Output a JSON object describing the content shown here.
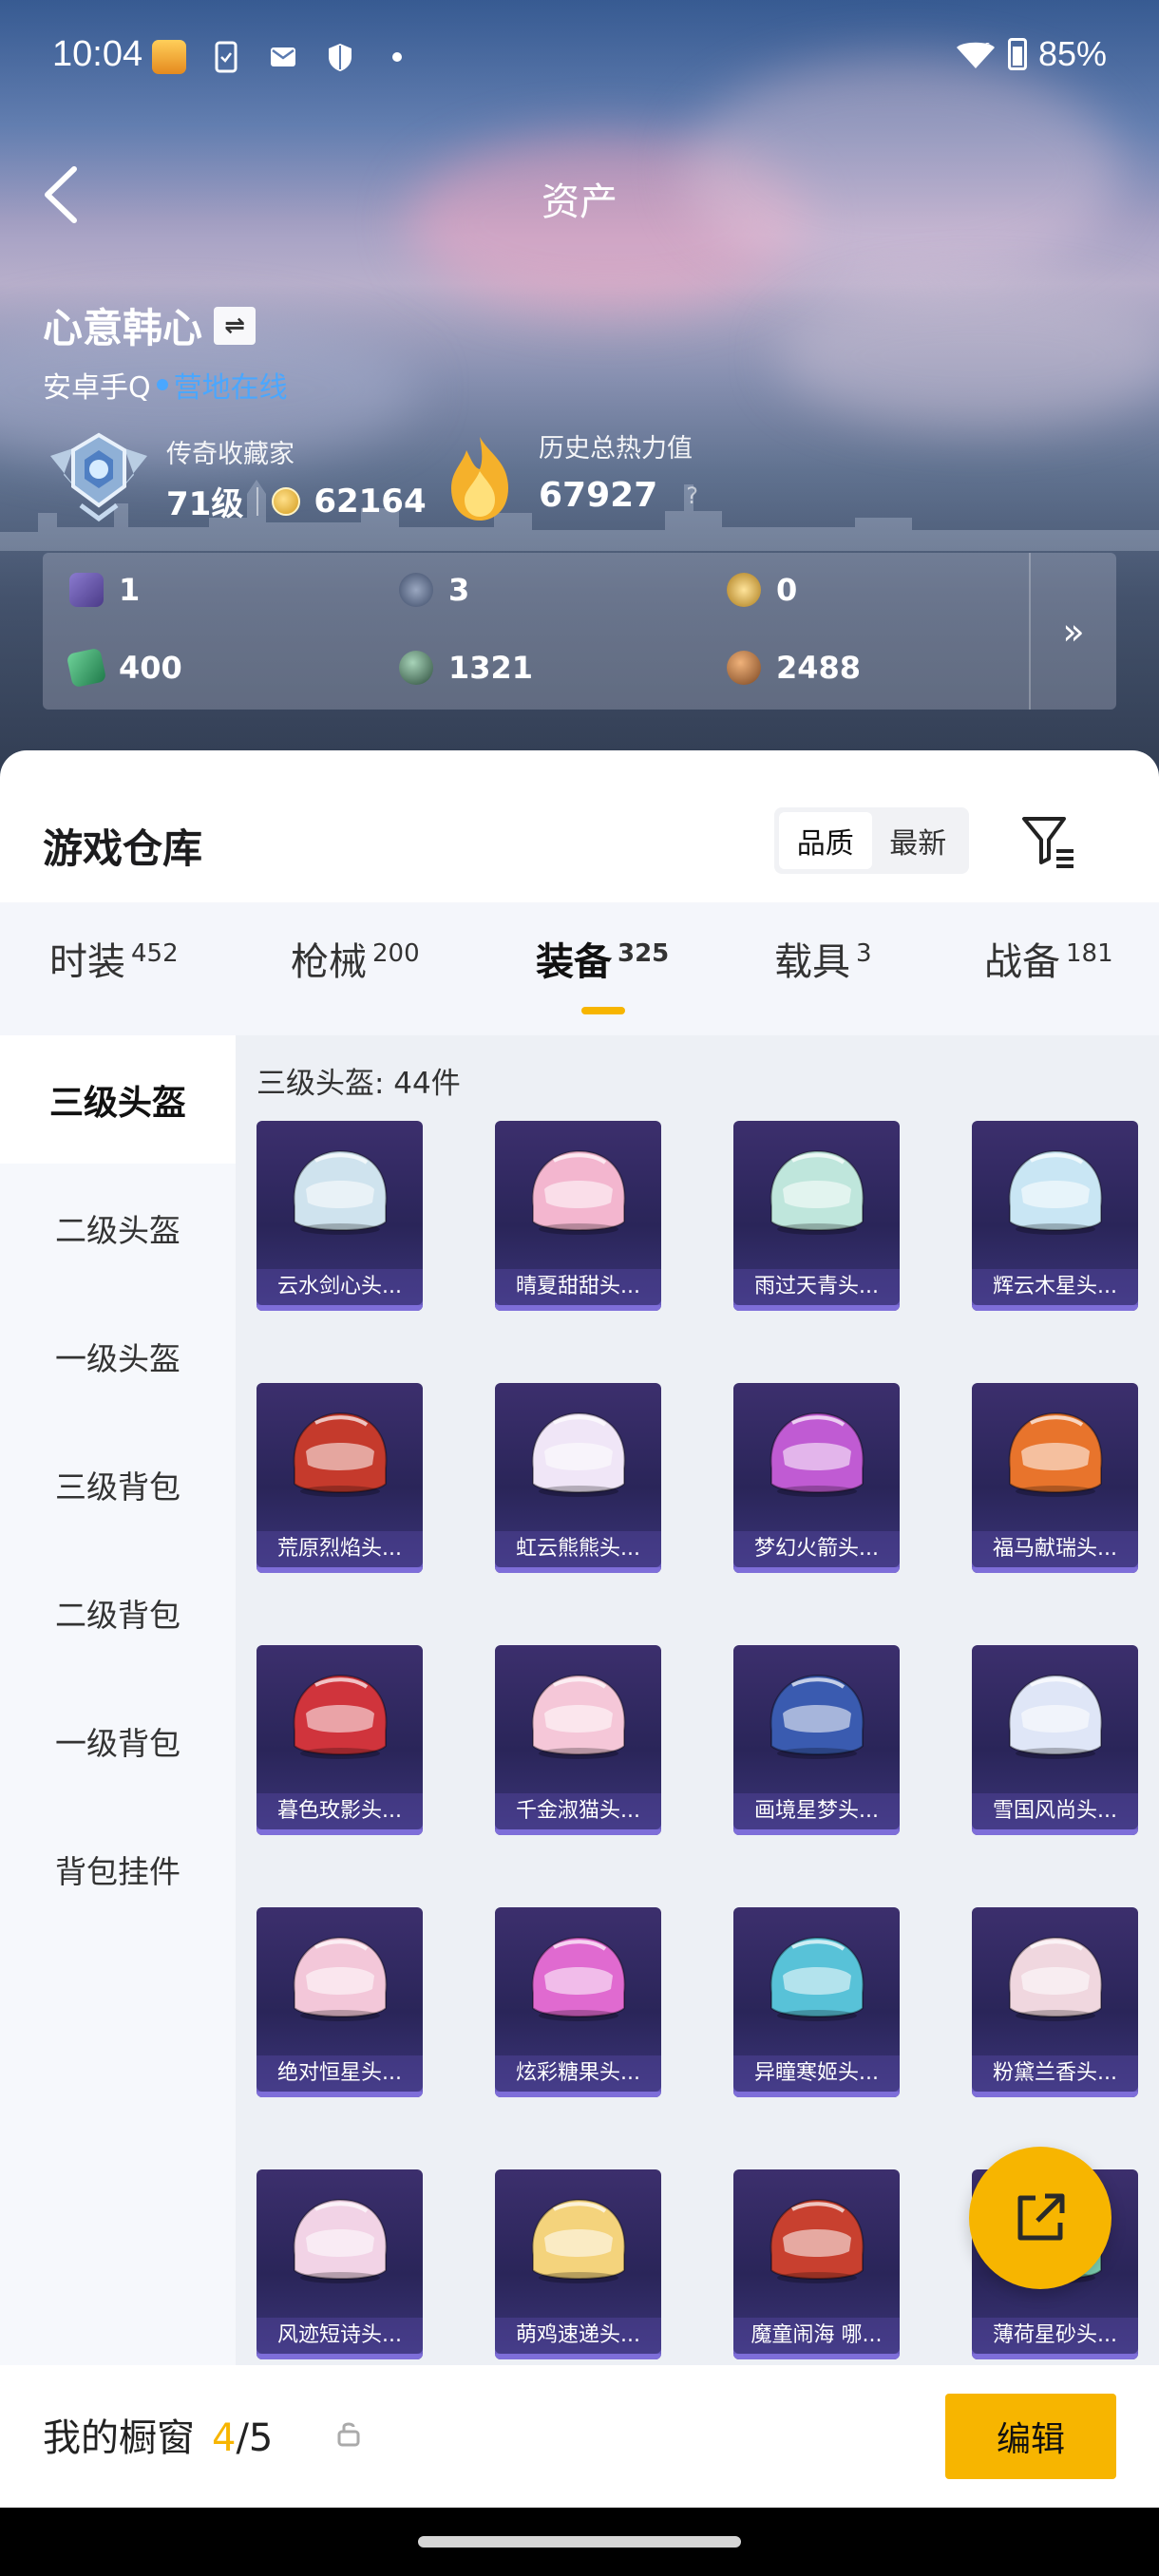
{
  "status_bar": {
    "time": "10:04",
    "battery": "85%"
  },
  "header": {
    "title": "资产"
  },
  "profile": {
    "name": "心意韩心",
    "platform": "安卓手Q",
    "online_status": "营地在线",
    "rank_label": "传奇收藏家",
    "level": "71级",
    "collection_points": "62164",
    "heat_label": "历史总热力值",
    "heat_value": "67927",
    "heat_help": "?"
  },
  "currency": {
    "items": [
      {
        "value": "1",
        "icon": "card-icon",
        "color": "#5b4a9a"
      },
      {
        "value": "3",
        "icon": "s-coin-icon",
        "color": "#4c5c79"
      },
      {
        "value": "0",
        "icon": "a-coin-icon",
        "color": "#c8a13b"
      },
      {
        "value": "400",
        "icon": "green-ticket-icon",
        "color": "#2e8f5a"
      },
      {
        "value": "1321",
        "icon": "orb-icon",
        "color": "#3f6b52"
      },
      {
        "value": "2488",
        "icon": "bronze-coin-icon",
        "color": "#a0642d"
      }
    ],
    "more": "»"
  },
  "warehouse": {
    "title": "游戏仓库",
    "sort_options": [
      "品质",
      "最新"
    ],
    "active_sort": "品质"
  },
  "tabs": [
    {
      "label": "时装",
      "count": "452"
    },
    {
      "label": "枪械",
      "count": "200"
    },
    {
      "label": "装备",
      "count": "325"
    },
    {
      "label": "载具",
      "count": "3"
    },
    {
      "label": "战备",
      "count": "181"
    }
  ],
  "active_tab": "装备",
  "sidebar": [
    {
      "label": "三级头盔"
    },
    {
      "label": "二级头盔"
    },
    {
      "label": "一级头盔"
    },
    {
      "label": "三级背包"
    },
    {
      "label": "二级背包"
    },
    {
      "label": "一级背包"
    },
    {
      "label": "背包挂件"
    }
  ],
  "content": {
    "count_line": "三级头盔: 44件",
    "items": [
      {
        "name": "云水剑心头...",
        "color": "#cfe3ee"
      },
      {
        "name": "晴夏甜甜头...",
        "color": "#f3b6cf"
      },
      {
        "name": "雨过天青头...",
        "color": "#bfe6dc"
      },
      {
        "name": "辉云木星头...",
        "color": "#c9e6f4"
      },
      {
        "name": "荒原烈焰头...",
        "color": "#c53a2c"
      },
      {
        "name": "虹云熊熊头...",
        "color": "#f0e6f7"
      },
      {
        "name": "梦幻火箭头...",
        "color": "#c05bd3"
      },
      {
        "name": "福马献瑞头...",
        "color": "#e8742c"
      },
      {
        "name": "暮色玫影头...",
        "color": "#d0343c"
      },
      {
        "name": "千金淑猫头...",
        "color": "#f5c7d8"
      },
      {
        "name": "画境星梦头...",
        "color": "#3a5bb0"
      },
      {
        "name": "雪国风尚头...",
        "color": "#dfe6f7"
      },
      {
        "name": "绝对恒星头...",
        "color": "#f3c7d9"
      },
      {
        "name": "炫彩糖果头...",
        "color": "#e06ad0"
      },
      {
        "name": "异瞳寒姬头...",
        "color": "#58c2d8"
      },
      {
        "name": "粉黛兰香头...",
        "color": "#f0d7df"
      },
      {
        "name": "风迹短诗头...",
        "color": "#f2d3e6"
      },
      {
        "name": "萌鸡速递头...",
        "color": "#f4d37c"
      },
      {
        "name": "魔童闹海 哪...",
        "color": "#c8402f"
      },
      {
        "name": "薄荷星砂头...",
        "color": "#7fd3b4"
      }
    ]
  },
  "showcase": {
    "label": "我的橱窗",
    "current": "4",
    "total": "/5",
    "edit_label": "编辑"
  },
  "colors": {
    "accent": "#f7b500",
    "online": "#4aa7ff"
  }
}
